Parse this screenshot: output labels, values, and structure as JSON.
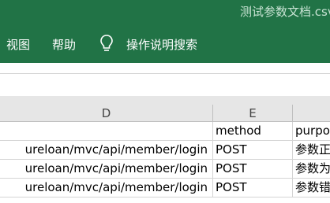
{
  "window": {
    "title": "测试参数文档.csv"
  },
  "ribbon": {
    "menu": [
      "视图",
      "帮助"
    ],
    "tell_me": "操作说明搜索",
    "tell_me_icon": "lightbulb-icon"
  },
  "sheet": {
    "columns": [
      "D",
      "E",
      ""
    ],
    "rows": [
      {
        "d": "",
        "e": "method",
        "f": "purpo"
      },
      {
        "d": "ureloan/mvc/api/member/login",
        "e": "POST",
        "f": "参数正"
      },
      {
        "d": "ureloan/mvc/api/member/login",
        "e": "POST",
        "f": "参数为"
      },
      {
        "d": "ureloan/mvc/api/member/login",
        "e": "POST",
        "f": "参数错"
      }
    ]
  },
  "colors": {
    "ribbon": "#217346",
    "header": "#e6e6e6",
    "gridline": "#d4d4d4"
  }
}
